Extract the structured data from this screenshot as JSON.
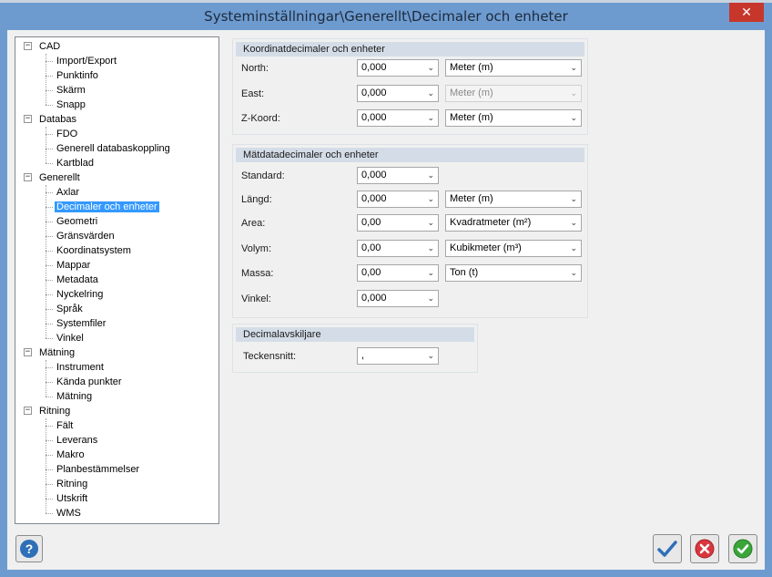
{
  "window": {
    "title": "Systeminställningar\\Generellt\\Decimaler och enheter",
    "close_glyph": "✕"
  },
  "tree": [
    {
      "label": "CAD",
      "expander": "−",
      "children": [
        "Import/Export",
        "Punktinfo",
        "Skärm",
        "Snapp"
      ]
    },
    {
      "label": "Databas",
      "expander": "−",
      "children": [
        "FDO",
        "Generell databaskoppling",
        "Kartblad"
      ]
    },
    {
      "label": "Generellt",
      "expander": "−",
      "children": [
        "Axlar",
        "Decimaler och enheter",
        "Geometri",
        "Gränsvärden",
        "Koordinatsystem",
        "Mappar",
        "Metadata",
        "Nyckelring",
        "Språk",
        "Systemfiler",
        "Vinkel"
      ]
    },
    {
      "label": "Mätning",
      "expander": "−",
      "children": [
        "Instrument",
        "Kända punkter",
        "Mätning"
      ]
    },
    {
      "label": "Ritning",
      "expander": "−",
      "children": [
        "Fält",
        "Leverans",
        "Makro",
        "Planbestämmelser",
        "Ritning",
        "Utskrift",
        "WMS"
      ]
    }
  ],
  "selected_item": "Decimaler och enheter",
  "coord": {
    "title": "Koordinatdecimaler och enheter",
    "rows": [
      {
        "label": "North:",
        "decimals": "0,000",
        "unit": "Meter (m)",
        "unit_disabled": false
      },
      {
        "label": "East:",
        "decimals": "0,000",
        "unit": "Meter (m)",
        "unit_disabled": true
      },
      {
        "label": "Z-Koord:",
        "decimals": "0,000",
        "unit": "Meter (m)",
        "unit_disabled": false
      }
    ]
  },
  "meas": {
    "title": "Mätdatadecimaler och enheter",
    "rows": [
      {
        "label": "Standard:",
        "decimals": "0,000",
        "unit": null
      },
      {
        "label": "Längd:",
        "decimals": "0,000",
        "unit": "Meter (m)"
      },
      {
        "label": "Area:",
        "decimals": "0,00",
        "unit": "Kvadratmeter (m²)"
      },
      {
        "label": "Volym:",
        "decimals": "0,00",
        "unit": "Kubikmeter (m³)"
      },
      {
        "label": "Massa:",
        "decimals": "0,00",
        "unit": "Ton (t)"
      },
      {
        "label": "Vinkel:",
        "decimals": "0,000",
        "unit": null
      }
    ]
  },
  "sep": {
    "title": "Decimalavskiljare",
    "label": "Teckensnitt:",
    "value": ","
  },
  "dropdown_glyph": "⌄",
  "help_glyph": "?",
  "colors": {
    "selection": "#3399ff",
    "close": "#c7362b",
    "ok_green": "#3aa63a",
    "cancel_red": "#d9363e",
    "apply_blue": "#2f6fb7"
  }
}
